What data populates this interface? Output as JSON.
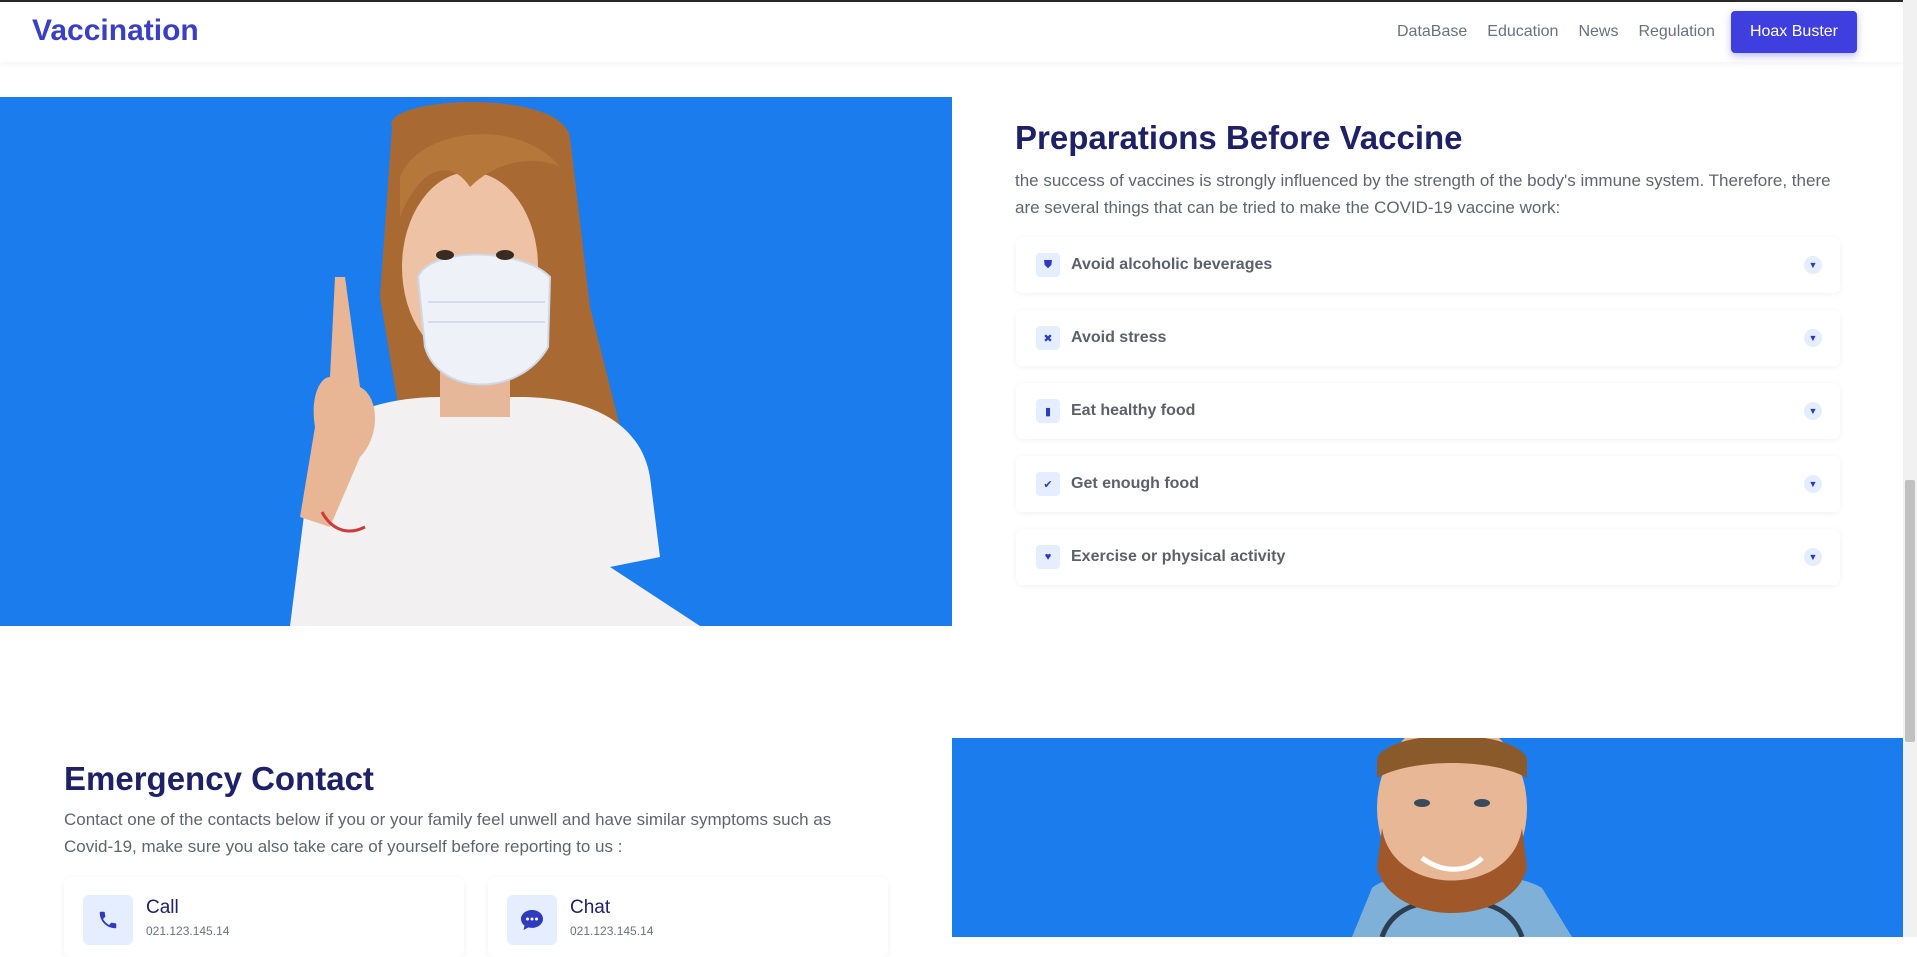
{
  "header": {
    "brand": "Vaccination",
    "nav": [
      "DataBase",
      "Education",
      "News",
      "Regulation"
    ],
    "cta": "Hoax Buster"
  },
  "preparations": {
    "title": "Preparations Before Vaccine",
    "text": "the success of vaccines is strongly influenced by the strength of the body's immune system. Therefore, there are several things that can be tried to make the COVID-19 vaccine work:",
    "items": [
      {
        "label": "Avoid alcoholic beverages",
        "icon": "shield-icon"
      },
      {
        "label": "Avoid stress",
        "icon": "x-square-icon"
      },
      {
        "label": "Eat healthy food",
        "icon": "bar-chart-icon"
      },
      {
        "label": "Get enough food",
        "icon": "check-square-icon"
      },
      {
        "label": "Exercise or physical activity",
        "icon": "heart-icon"
      }
    ]
  },
  "emergency": {
    "title": "Emergency Contact",
    "text": "Contact one of the contacts below if you or your family feel unwell and have similar symptoms such as Covid-19, make sure you also take care of yourself before reporting to us :",
    "contacts": [
      {
        "title": "Call",
        "value": "021.123.145.14",
        "icon": "phone-icon"
      },
      {
        "title": "Chat",
        "value": "021.123.145.14",
        "icon": "chat-icon"
      }
    ]
  },
  "colors": {
    "accent": "#3f3fe0",
    "heading": "#1f2167",
    "image_bg": "#1b7ced"
  }
}
